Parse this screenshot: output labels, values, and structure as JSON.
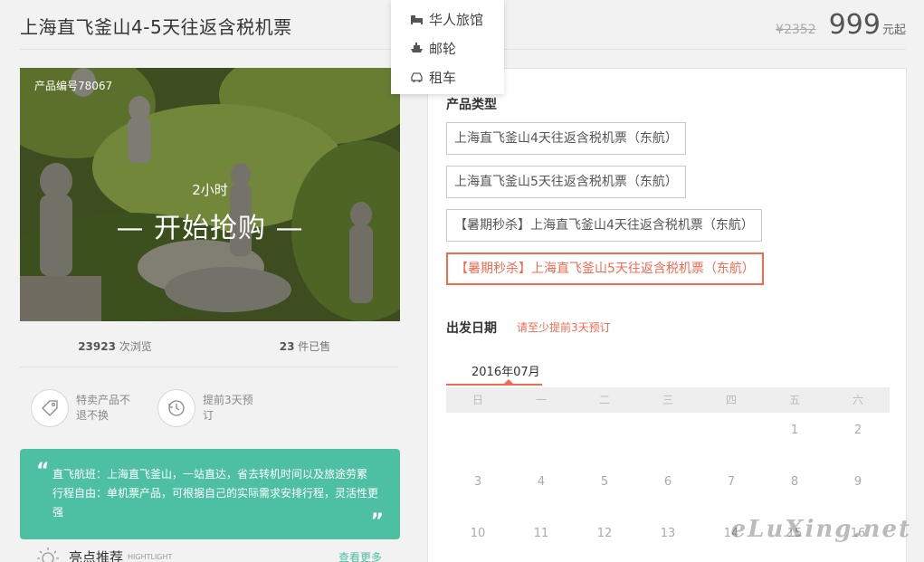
{
  "page": {
    "title": "上海直飞釜山4-5天往返含税机票",
    "old_price": "¥2352",
    "price": "999",
    "price_suffix": "元起"
  },
  "dropdown": {
    "items": [
      {
        "label": "华人旅馆",
        "icon": "hotel-icon"
      },
      {
        "label": "邮轮",
        "icon": "cruise-ship-icon"
      },
      {
        "label": "租车",
        "icon": "car-icon"
      }
    ]
  },
  "hero": {
    "product_id": "产品编号78067",
    "countdown": "2小时",
    "start_label": "— 开始抢购 —"
  },
  "stats": {
    "views_count": "23923",
    "views_label": " 次浏览",
    "sold_count": "23",
    "sold_label": " 件已售"
  },
  "features": [
    {
      "text": "特卖产品不退不换",
      "icon": "tag-icon"
    },
    {
      "text": "提前3天预订",
      "icon": "clock-history-icon"
    }
  ],
  "quote": {
    "open_mark": "“",
    "close_mark": "”",
    "line1": "直飞航班：上海直飞釜山，一站直达，省去转机时间以及旅途劳累",
    "line2": "行程自由：单机票产品，可根据自己的实际需求安排行程，灵活性更强"
  },
  "highlights": {
    "title": "亮点推荐",
    "subtitle": "HIGHTLIGHT",
    "see_more": "查看更多"
  },
  "product_types": {
    "label": "产品类型",
    "options": [
      {
        "label": "上海直飞釜山4天往返含税机票（东航）",
        "selected": false
      },
      {
        "label": "上海直飞釜山5天往返含税机票（东航）",
        "selected": false
      },
      {
        "label": "【暑期秒杀】上海直飞釜山4天往返含税机票（东航）",
        "selected": false
      },
      {
        "label": "【暑期秒杀】上海直飞釜山5天往返含税机票（东航）",
        "selected": true
      }
    ]
  },
  "departure": {
    "label": "出发日期",
    "hint": "请至少提前3天预订",
    "month": "2016年07月",
    "weekdays": [
      "日",
      "一",
      "二",
      "三",
      "四",
      "五",
      "六"
    ],
    "days": [
      "",
      "",
      "",
      "",
      "",
      "1",
      "2",
      "3",
      "4",
      "5",
      "6",
      "7",
      "8",
      "9",
      "10",
      "11",
      "12",
      "13",
      "14",
      "15",
      "16"
    ]
  },
  "watermark": "eLuXing.net",
  "colors": {
    "accent": "#f26b51",
    "teal": "#4dc0a3"
  }
}
